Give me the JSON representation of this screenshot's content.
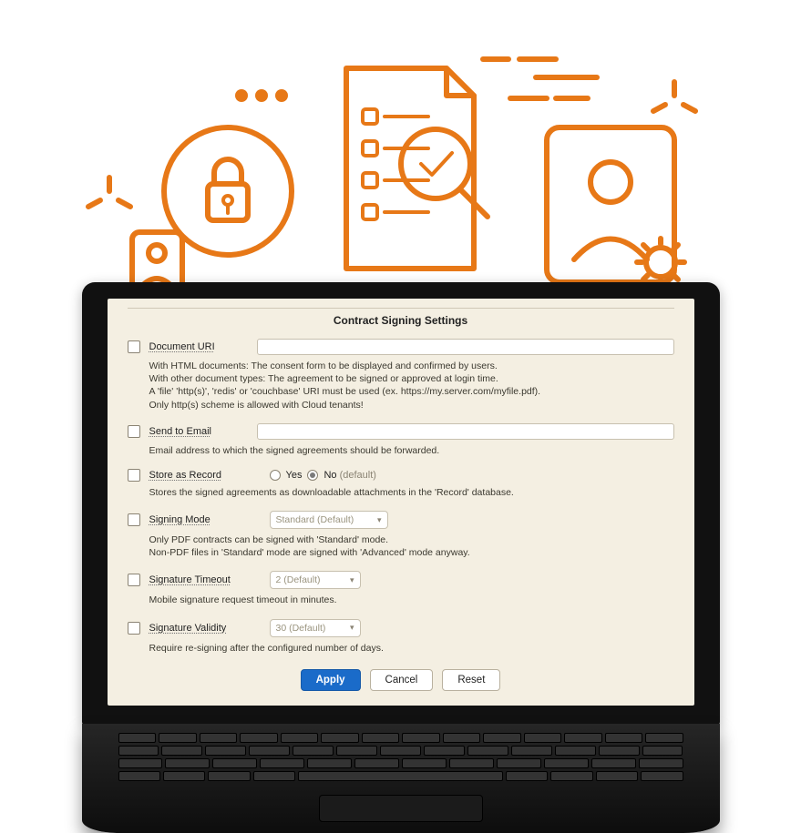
{
  "title": "Contract Signing Settings",
  "fields": {
    "doc_uri": {
      "label": "Document URI",
      "desc": "With HTML documents: The consent form to be displayed and confirmed by users.\nWith other document types: The agreement to be signed or approved at login time.\nA 'file' 'http(s)', 'redis' or 'couchbase' URI must be used (ex. https://my.server.com/myfile.pdf).\nOnly http(s) scheme is allowed with Cloud tenants!"
    },
    "send_email": {
      "label": "Send to Email",
      "desc": "Email address to which the signed agreements should be forwarded."
    },
    "store_record": {
      "label": "Store as Record",
      "yes": "Yes",
      "no": "No",
      "default_suffix": "(default)",
      "desc": "Stores the signed agreements as downloadable attachments in the 'Record' database."
    },
    "signing_mode": {
      "label": "Signing Mode",
      "value": "Standard (Default)",
      "desc": "Only PDF contracts can be signed with 'Standard' mode.\nNon-PDF files in 'Standard' mode are signed with 'Advanced' mode anyway."
    },
    "sig_timeout": {
      "label": "Signature Timeout",
      "value": "2 (Default)",
      "desc": "Mobile signature request timeout in minutes."
    },
    "sig_validity": {
      "label": "Signature Validity",
      "value": "30 (Default)",
      "desc": "Require re-signing after the configured number of days."
    }
  },
  "buttons": {
    "apply": "Apply",
    "cancel": "Cancel",
    "reset": "Reset"
  }
}
